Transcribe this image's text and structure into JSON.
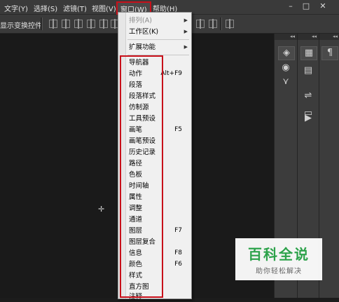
{
  "menubar": {
    "items": [
      {
        "label": "文字(Y)"
      },
      {
        "label": "选择(S)"
      },
      {
        "label": "滤镜(T)"
      },
      {
        "label": "视图(V)"
      },
      {
        "label": "窗口(W)"
      },
      {
        "label": "帮助(H)"
      }
    ]
  },
  "options_bar": {
    "label": "显示变换控件"
  },
  "window_menu": {
    "top_items": [
      {
        "label": "排列(A)",
        "disabled": true,
        "submenu": true
      },
      {
        "label": "工作区(K)",
        "disabled": false,
        "submenu": true
      },
      {
        "label": "扩展功能",
        "disabled": false,
        "submenu": true
      }
    ],
    "items": [
      {
        "label": "导航器",
        "shortcut": ""
      },
      {
        "label": "动作",
        "shortcut": "Alt+F9"
      },
      {
        "label": "段落",
        "shortcut": ""
      },
      {
        "label": "段落样式",
        "shortcut": ""
      },
      {
        "label": "仿制源",
        "shortcut": ""
      },
      {
        "label": "工具预设",
        "shortcut": ""
      },
      {
        "label": "画笔",
        "shortcut": "F5"
      },
      {
        "label": "画笔预设",
        "shortcut": ""
      },
      {
        "label": "历史记录",
        "shortcut": ""
      },
      {
        "label": "路径",
        "shortcut": ""
      },
      {
        "label": "色板",
        "shortcut": ""
      },
      {
        "label": "时间轴",
        "shortcut": ""
      },
      {
        "label": "属性",
        "shortcut": ""
      },
      {
        "label": "调整",
        "shortcut": ""
      },
      {
        "label": "通道",
        "shortcut": ""
      },
      {
        "label": "图层",
        "shortcut": "F7"
      },
      {
        "label": "图层复合",
        "shortcut": ""
      },
      {
        "label": "信息",
        "shortcut": "F8"
      },
      {
        "label": "颜色",
        "shortcut": "F6"
      },
      {
        "label": "样式",
        "shortcut": ""
      },
      {
        "label": "直方图",
        "shortcut": ""
      },
      {
        "label": "注释",
        "shortcut": ""
      }
    ]
  },
  "watermark": {
    "logo": "百科全说",
    "tagline": "助你轻松解决"
  },
  "colors": {
    "highlight": "#c8101a",
    "watermark_green": "#2ca24a"
  }
}
